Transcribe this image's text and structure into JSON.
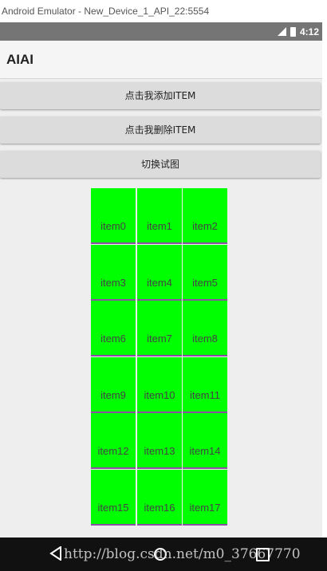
{
  "window": {
    "title": "Android Emulator - New_Device_1_API_22:5554"
  },
  "status_bar": {
    "time": "4:12",
    "icons": [
      "signal-icon",
      "battery-icon"
    ]
  },
  "app": {
    "title": "AIAI"
  },
  "buttons": {
    "add_label": "点击我添加ITEM",
    "delete_label": "点击我删除ITEM",
    "switch_label": "切换试图"
  },
  "grid": {
    "items": [
      "item0",
      "item1",
      "item2",
      "item3",
      "item4",
      "item5",
      "item6",
      "item7",
      "item8",
      "item9",
      "item10",
      "item11",
      "item12",
      "item13",
      "item14",
      "item15",
      "item16",
      "item17"
    ],
    "columns": 3
  },
  "colors": {
    "cell_background": "#00ff00",
    "divider": "#8a4fa3",
    "status_bar": "#757575"
  },
  "nav_bar": {
    "icons": [
      "back-icon",
      "home-icon",
      "recent-apps-icon"
    ]
  },
  "watermark": {
    "text": "http://blog.csdn.net/m0_37667770"
  }
}
